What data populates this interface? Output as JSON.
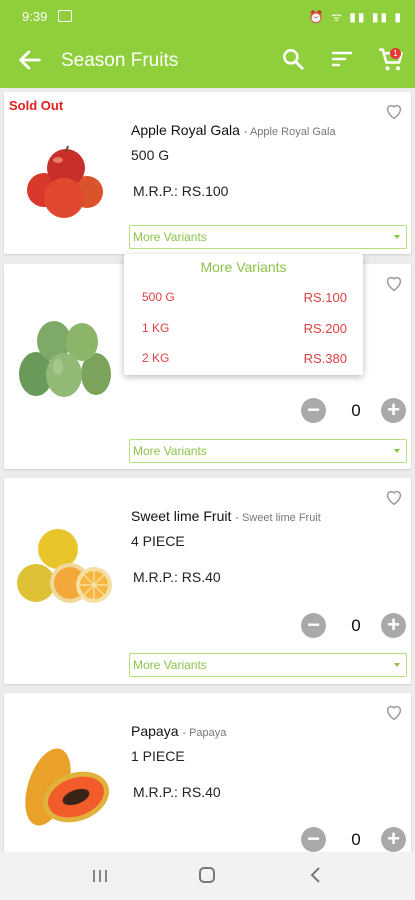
{
  "status": {
    "time": "9:39",
    "icons": "⏰ ᯤ ▮▮ ▮▮ ▮"
  },
  "app_bar": {
    "title": "Season Fruits",
    "cart_count": "1"
  },
  "products": [
    {
      "sold_out": "Sold Out",
      "name": "Apple Royal Gala",
      "sub": "- Apple Royal Gala",
      "qty": "500 G",
      "price": "M.R.P.: RS.100",
      "variants_label": "More Variants"
    },
    {
      "count": "0",
      "variants_label": "More Variants"
    },
    {
      "name": "Sweet lime Fruit",
      "sub": "- Sweet lime Fruit",
      "qty": "4 PIECE",
      "price": "M.R.P.: RS.40",
      "count": "0",
      "variants_label": "More Variants"
    },
    {
      "name": "Papaya",
      "sub": "- Papaya",
      "qty": "1 PIECE",
      "price": "M.R.P.: RS.40",
      "count": "0"
    }
  ],
  "dropdown": {
    "title": "More Variants",
    "options": [
      {
        "label": "500 G",
        "price": "RS.100"
      },
      {
        "label": "1 KG",
        "price": "RS.200"
      },
      {
        "label": "2 KG",
        "price": "RS.380"
      }
    ]
  },
  "colors": {
    "accent": "#8fcf3c",
    "sold_out": "#e0201b",
    "variant_text": "#8bc34a",
    "price_red": "#e04040"
  },
  "icons": [
    "back-arrow-icon",
    "search-icon",
    "sort-icon",
    "cart-icon",
    "heart-icon",
    "minus-icon",
    "plus-icon",
    "chevron-down-icon",
    "recent-apps-icon",
    "home-icon",
    "nav-back-icon"
  ]
}
